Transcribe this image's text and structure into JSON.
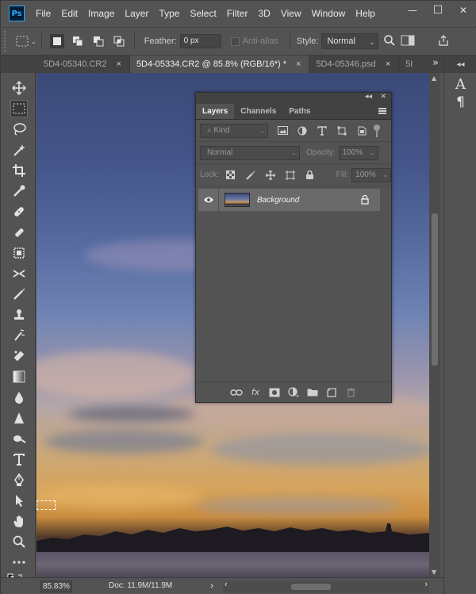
{
  "app": {
    "logo": "Ps"
  },
  "menu": [
    "File",
    "Edit",
    "Image",
    "Layer",
    "Type",
    "Select",
    "Filter",
    "3D",
    "View",
    "Window",
    "Help"
  ],
  "window_controls": {
    "minimize": "—",
    "restore": "☐",
    "close": "✕"
  },
  "options": {
    "feather_label": "Feather:",
    "feather_value": "0 px",
    "antialias_label": "Anti-alias",
    "style_label": "Style:",
    "style_value": "Normal"
  },
  "tabs": [
    {
      "label": "5D4-05340.CR2",
      "close": "×"
    },
    {
      "label": "5D4-05334.CR2 @ 85.8% (RGB/16*) *",
      "close": "×"
    },
    {
      "label": "5D4-05346.psd",
      "close": "×"
    },
    {
      "label": "5I"
    }
  ],
  "tab_overflow": "»",
  "status": {
    "zoom": "85.83%",
    "doc": "Doc: 11.9M/11.9M",
    "arrow": "›",
    "scroll_left": "‹",
    "scroll_right": "›"
  },
  "dock": {
    "collapse": "◂◂",
    "character_icon": "A",
    "paragraph_icon": "¶"
  },
  "layers_panel": {
    "collapse": "◂◂",
    "close": "✕",
    "tabs": [
      "Layers",
      "Channels",
      "Paths"
    ],
    "kind_label": "Kind",
    "blend_mode": "Normal",
    "opacity_label": "Opacity:",
    "opacity_value": "100%",
    "lock_label": "Lock:",
    "fill_label": "Fill:",
    "fill_value": "100%",
    "layer_name": "Background",
    "footer_icons": [
      "link-icon",
      "fx-icon",
      "mask-icon",
      "adjustment-icon",
      "folder-icon",
      "new-layer-icon",
      "trash-icon"
    ],
    "fx_label": "fx"
  },
  "colors": {
    "ui_bg": "#535353",
    "tab_bg": "#424242",
    "accent_ps": "#31a8ff",
    "selected_layer": "#6a6a6a"
  }
}
